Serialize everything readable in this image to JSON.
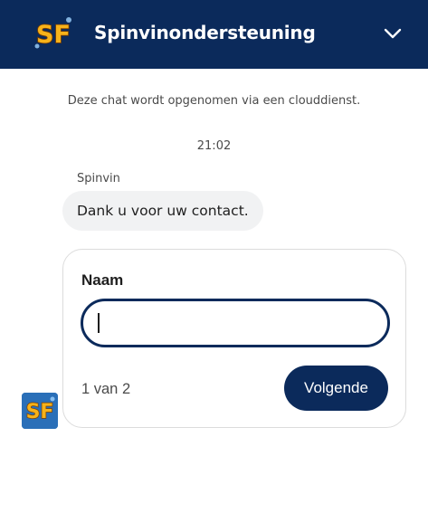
{
  "header": {
    "title": "Spinvinondersteuning",
    "logo_icon": "sf-logo-icon",
    "collapse_icon": "chevron-down-icon",
    "background": "#0b2a5b"
  },
  "chat": {
    "notice": "Deze chat wordt opgenomen via een clouddienst.",
    "timestamp": "21:02",
    "sender": "Spinvin",
    "message": "Dank u voor uw contact."
  },
  "form": {
    "field_label": "Naam",
    "field_value": "",
    "step": "1 van 2",
    "next_label": "Volgende",
    "accent": "#0b2a5b"
  },
  "agent": {
    "avatar_icon": "sf-logo-icon"
  }
}
